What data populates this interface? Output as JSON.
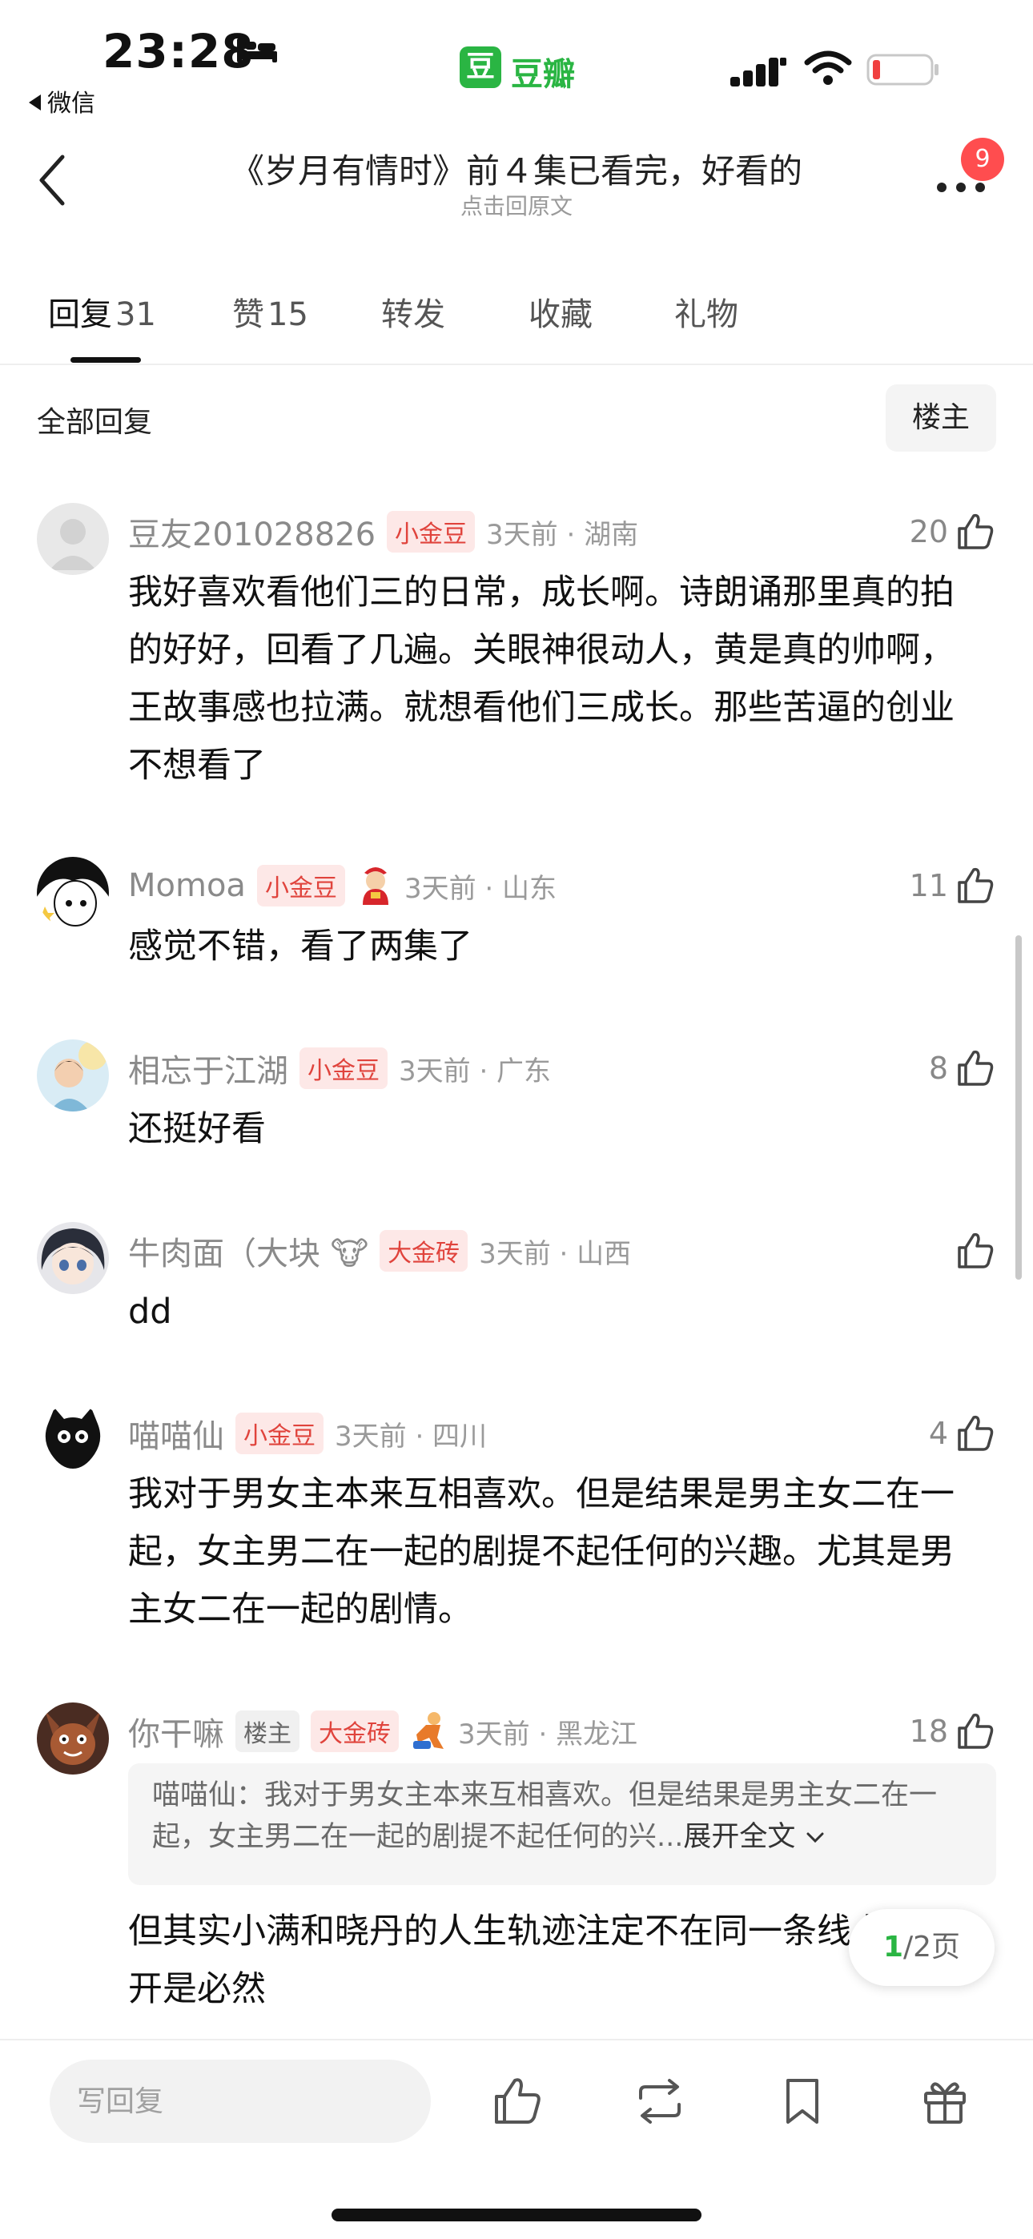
{
  "status_bar": {
    "time": "23:28",
    "back_app": "微信",
    "app_logo_char": "豆",
    "app_name": "豆瓣"
  },
  "header": {
    "title": "《岁月有情时》前４集已看完，好看的",
    "subtitle": "点击回原文",
    "badge": "9"
  },
  "tabs": [
    {
      "label": "回复",
      "count": "31"
    },
    {
      "label": "赞",
      "count": "15"
    },
    {
      "label": "转发",
      "count": ""
    },
    {
      "label": "收藏",
      "count": ""
    },
    {
      "label": "礼物",
      "count": ""
    }
  ],
  "filter": {
    "title": "全部回复",
    "owner": "楼主"
  },
  "comments": [
    {
      "user": "豆友201028826",
      "tag": "小金豆",
      "time_loc": "3天前 · 湖南",
      "likes": "20",
      "text": "我好喜欢看他们三的日常，成长啊。诗朗诵那里真的拍的好好，回看了几遍。关眼神很动人，黄是真的帅啊，王故事感也拉满。就想看他们三成长。那些苦逼的创业不想看了"
    },
    {
      "user": "Momoa",
      "tag": "小金豆",
      "time_loc": "3天前 · 山东",
      "likes": "11",
      "text": "感觉不错，看了两集了"
    },
    {
      "user": "相忘于江湖",
      "tag": "小金豆",
      "time_loc": "3天前 · 广东",
      "likes": "8",
      "text": "还挺好看"
    },
    {
      "user": "牛肉面（大块",
      "user_emoji": "🐮",
      "tag": "大金砖",
      "time_loc": "3天前 · 山西",
      "likes": "",
      "text": "dd"
    },
    {
      "user": "喵喵仙",
      "tag": "小金豆",
      "time_loc": "3天前 · 四川",
      "likes": "4",
      "text": "我对于男女主本来互相喜欢。但是结果是男主女二在一起，女主男二在一起的剧提不起任何的兴趣。尤其是男主女二在一起的剧情。"
    },
    {
      "user": "你干嘛",
      "owner_tag": "楼主",
      "tag": "大金砖",
      "time_loc": "3天前 · 黑龙江",
      "likes": "18",
      "quote": "喵喵仙：我对于男女主本来互相喜欢。但是结果是男主女二在一起，女主男二在一起的剧提不起任何的兴...",
      "quote_expand": "展开全文",
      "text": "但其实小满和晓丹的人生轨迹注定不在同一条线上，分开是必然"
    }
  ],
  "pagination": {
    "current": "1",
    "total": "/2页"
  },
  "bottom_bar": {
    "reply_placeholder": "写回复"
  },
  "colors": {
    "brand_green": "#2ab543",
    "tag_red": "#e0433c",
    "badge_red": "#ff4d4f"
  }
}
